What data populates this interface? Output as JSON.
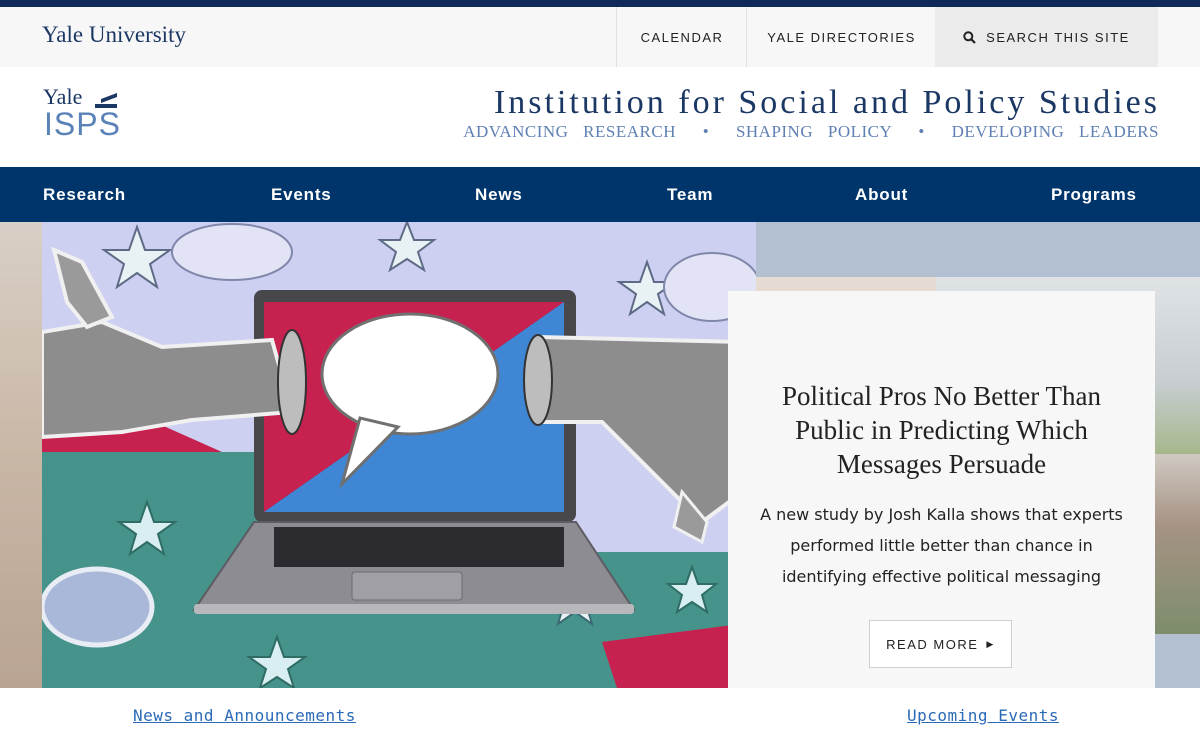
{
  "header": {
    "yale_wordmark": "Yale University",
    "links": [
      {
        "label": "CALENDAR"
      },
      {
        "label": "YALE DIRECTORIES"
      }
    ],
    "search_label": "SEARCH THIS SITE"
  },
  "branding": {
    "logo_line1": "Yale",
    "logo_line2": "ISPS",
    "title": "Institution for Social and Policy Studies",
    "tagline_parts": [
      "ADVANCING RESEARCH",
      "SHAPING POLICY",
      "DEVELOPING LEADERS"
    ],
    "tagline_separator": "•",
    "colors": {
      "navy": "#00356b",
      "light_blue": "#5b82b7"
    }
  },
  "nav": {
    "items": [
      "Research",
      "Events",
      "News",
      "Team",
      "About",
      "Programs"
    ]
  },
  "feature": {
    "title": "Political Pros No Better Than Public in Predicting Which Messages Persuade",
    "description": "A new study by Josh Kalla shows that experts performed little better than chance in identifying effective political messaging",
    "button_label": "READ MORE",
    "button_icon": "triangle-right-icon",
    "image_alt": "laptop-speech-bubble-thumbs-illustration"
  },
  "sections": {
    "news_link": "News and Announcements",
    "events_link": "Upcoming Events"
  }
}
